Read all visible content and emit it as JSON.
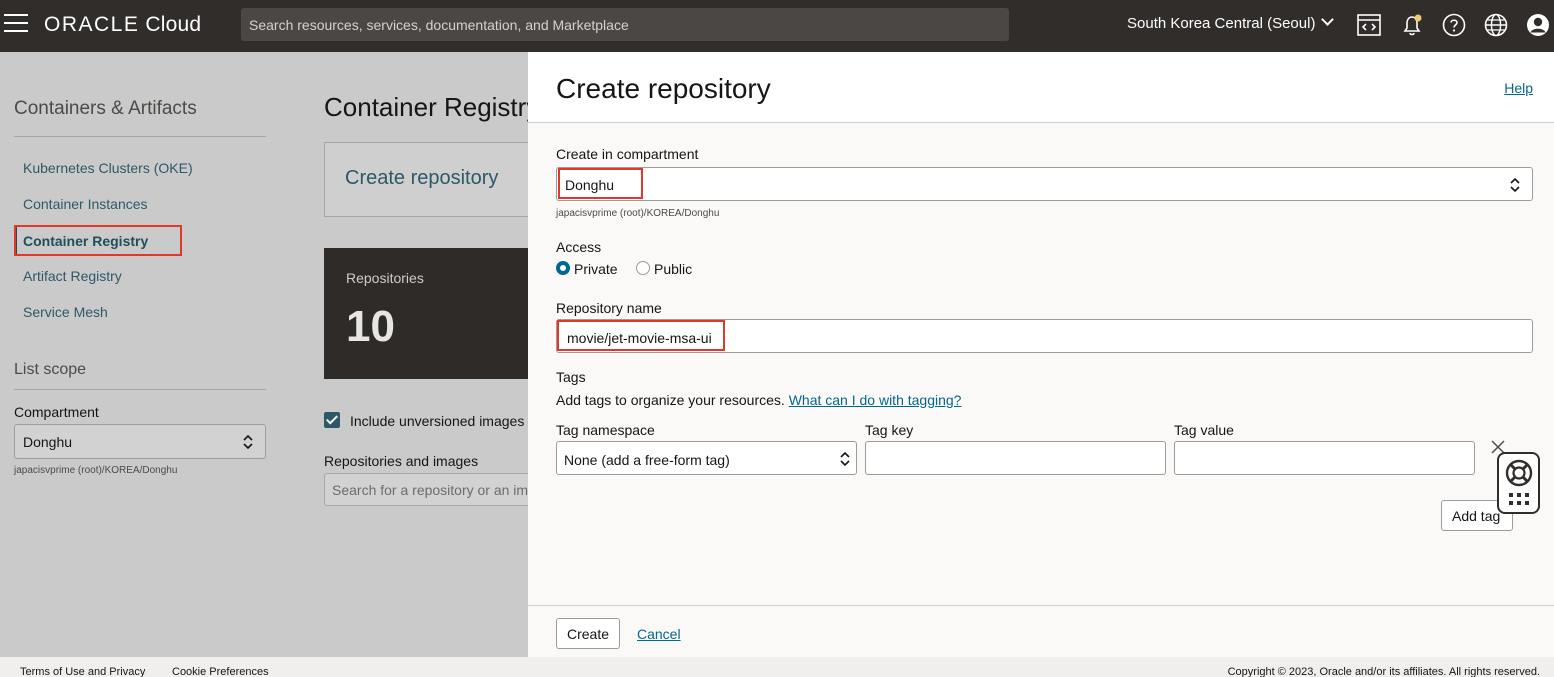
{
  "topbar": {
    "logo_brand": "ORACLE",
    "logo_product": "Cloud",
    "search_placeholder": "Search resources, services, documentation, and Marketplace",
    "region": "South Korea Central (Seoul)"
  },
  "sidebar": {
    "title": "Containers & Artifacts",
    "items": [
      {
        "label": "Kubernetes Clusters (OKE)"
      },
      {
        "label": "Container Instances"
      },
      {
        "label": "Container Registry"
      },
      {
        "label": "Artifact Registry"
      },
      {
        "label": "Service Mesh"
      }
    ],
    "scope_title": "List scope",
    "compartment_label": "Compartment",
    "compartment_value": "Donghu",
    "compartment_path": "japacisvprime (root)/KOREA/Donghu"
  },
  "main": {
    "title": "Container Registry",
    "create_card_label": "Create repository",
    "repositories_label": "Repositories",
    "repositories_count": "10",
    "include_unversioned_label": "Include unversioned images",
    "repos_images_label": "Repositories and images",
    "search_placeholder": "Search for a repository or an image"
  },
  "drawer": {
    "title": "Create repository",
    "help": "Help",
    "compartment_label": "Create in compartment",
    "compartment_value": "Donghu",
    "compartment_path": "japacisvprime (root)/KOREA/Donghu",
    "access_label": "Access",
    "access_private": "Private",
    "access_public": "Public",
    "repo_name_label": "Repository name",
    "repo_name_value": "movie/jet-movie-msa-ui",
    "tags_label": "Tags",
    "tags_desc": "Add tags to organize your resources.",
    "tags_link": "What can I do with tagging?",
    "tag_namespace_label": "Tag namespace",
    "tag_namespace_value": "None (add a free-form tag)",
    "tag_key_label": "Tag key",
    "tag_key_value": "",
    "tag_value_label": "Tag value",
    "tag_value_value": "",
    "add_tag": "Add tag",
    "create": "Create",
    "cancel": "Cancel"
  },
  "footer": {
    "terms": "Terms of Use and Privacy",
    "cookies": "Cookie Preferences",
    "copyright": "Copyright © 2023, Oracle and/or its affiliates. All rights reserved."
  }
}
